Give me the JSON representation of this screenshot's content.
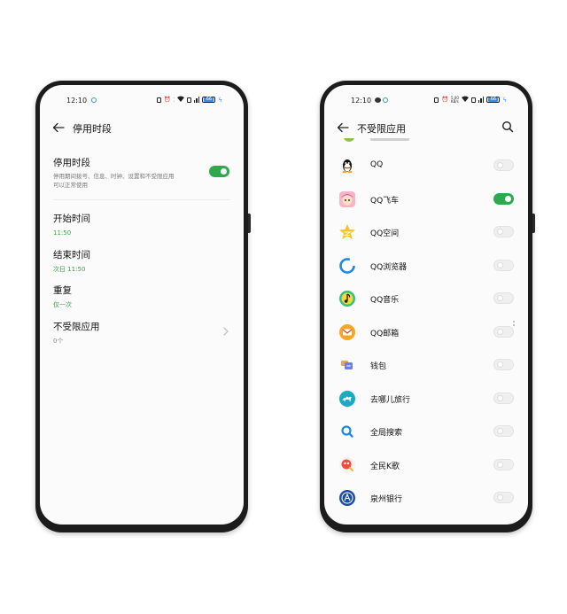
{
  "left_phone": {
    "status": {
      "time": "12:10",
      "battery": "66"
    },
    "header": {
      "title": "停用时段"
    },
    "rows": {
      "disable_period": {
        "title": "停用时段",
        "subtitle_line1": "停用期间拨号、信息、时钟、设置和不受限应用",
        "subtitle_line2": "可以正常使用",
        "enabled": true
      },
      "start_time": {
        "title": "开始时间",
        "value": "11:50"
      },
      "end_time": {
        "title": "结束时间",
        "value": "次日 11:50"
      },
      "repeat": {
        "title": "重复",
        "value": "仅一次"
      },
      "unrestricted_apps": {
        "title": "不受限应用",
        "value": "0个"
      }
    }
  },
  "right_phone": {
    "status": {
      "time": "12:10",
      "speed": "5.00",
      "speed_unit": "KB/s",
      "battery": "66"
    },
    "header": {
      "title": "不受限应用"
    },
    "apps": [
      {
        "name": "QQ",
        "icon": "qq-penguin-icon",
        "enabled": false
      },
      {
        "name": "QQ飞车",
        "icon": "qq-speed-icon",
        "enabled": true
      },
      {
        "name": "QQ空间",
        "icon": "qzone-star-icon",
        "enabled": false
      },
      {
        "name": "QQ浏览器",
        "icon": "qq-browser-icon",
        "enabled": false
      },
      {
        "name": "QQ音乐",
        "icon": "qq-music-icon",
        "enabled": false
      },
      {
        "name": "QQ邮箱",
        "icon": "qq-mail-icon",
        "enabled": false
      },
      {
        "name": "钱包",
        "icon": "wallet-icon",
        "enabled": false
      },
      {
        "name": "去哪儿旅行",
        "icon": "qunar-camel-icon",
        "enabled": false
      },
      {
        "name": "全局搜索",
        "icon": "global-search-icon",
        "enabled": false
      },
      {
        "name": "全民K歌",
        "icon": "karaoke-icon",
        "enabled": false
      },
      {
        "name": "泉州银行",
        "icon": "quanzhou-bank-icon",
        "enabled": false
      }
    ]
  },
  "colors": {
    "toggle_on": "#2daa4d",
    "value_green": "#35a34f",
    "frame": "#1c1c1c"
  }
}
